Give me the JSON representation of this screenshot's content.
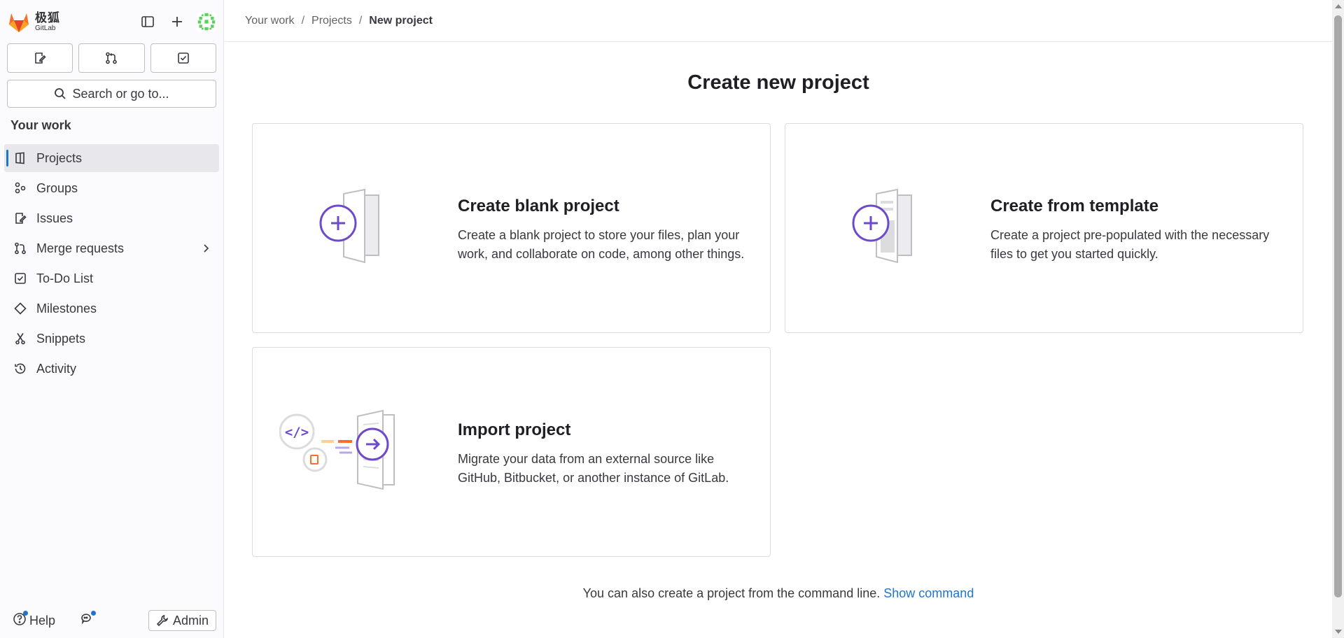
{
  "app": {
    "logo_cn": "极狐",
    "logo_en": "GitLab"
  },
  "sidebar": {
    "search_label": "Search or go to...",
    "section_title": "Your work",
    "items": [
      {
        "label": "Projects",
        "icon": "project-icon",
        "active": true
      },
      {
        "label": "Groups",
        "icon": "group-icon"
      },
      {
        "label": "Issues",
        "icon": "issues-icon"
      },
      {
        "label": "Merge requests",
        "icon": "merge-request-icon"
      },
      {
        "label": "To-Do List",
        "icon": "todo-icon"
      },
      {
        "label": "Milestones",
        "icon": "milestone-icon"
      },
      {
        "label": "Snippets",
        "icon": "snippet-icon"
      },
      {
        "label": "Activity",
        "icon": "history-icon"
      }
    ],
    "help_label": "Help",
    "admin_label": "Admin"
  },
  "breadcrumb": {
    "items": [
      "Your work",
      "Projects"
    ],
    "current": "New project"
  },
  "page": {
    "title": "Create new project"
  },
  "cards": [
    {
      "title": "Create blank project",
      "desc": "Create a blank project to store your files, plan your work, and collaborate on code, among other things."
    },
    {
      "title": "Create from template",
      "desc": "Create a project pre-populated with the necessary files to get you started quickly."
    },
    {
      "title": "Import project",
      "desc": "Migrate your data from an external source like GitHub, Bitbucket, or another instance of GitLab."
    }
  ],
  "cli": {
    "text": "You can also create a project from the command line.",
    "link": "Show command"
  },
  "colors": {
    "accent_purple": "#6e49cb",
    "link_blue": "#1f75cb",
    "logo_orange": "#fc6d26"
  }
}
